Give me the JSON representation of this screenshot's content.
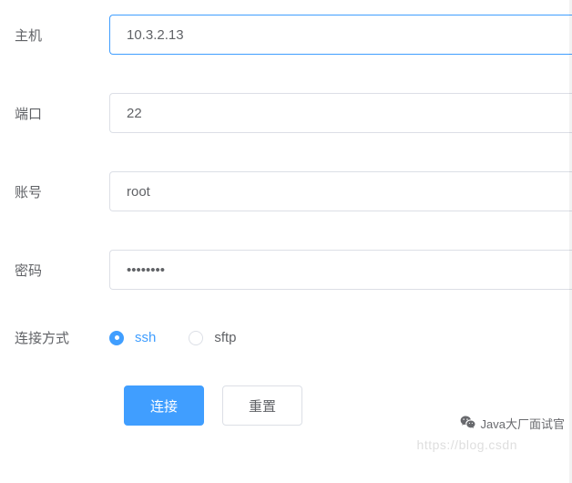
{
  "fields": {
    "host": {
      "label": "主机",
      "value": "10.3.2.13"
    },
    "port": {
      "label": "端口",
      "value": "22"
    },
    "account": {
      "label": "账号",
      "value": "root"
    },
    "password": {
      "label": "密码",
      "value": "••••••••"
    },
    "method": {
      "label": "连接方式",
      "selected": "ssh",
      "options": {
        "ssh": "ssh",
        "sftp": "sftp"
      }
    }
  },
  "buttons": {
    "connect": "连接",
    "reset": "重置"
  },
  "watermark": {
    "text": "Java大厂面试官"
  },
  "watermark2": "https://blog.csdn"
}
